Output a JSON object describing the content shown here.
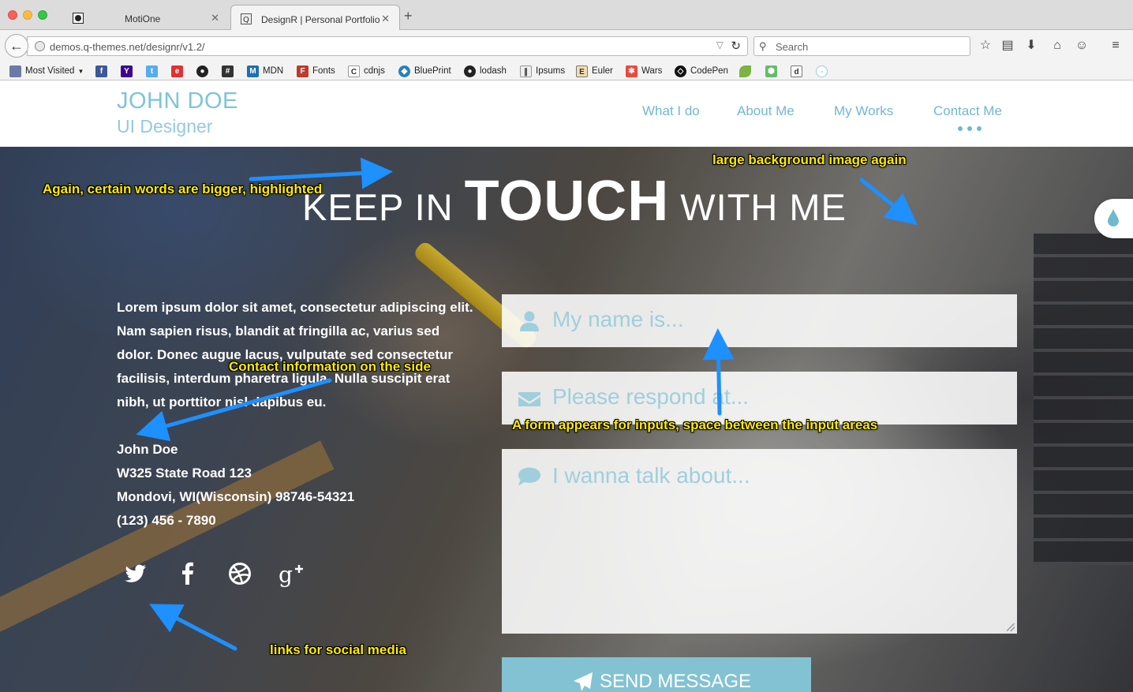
{
  "browser": {
    "tabs": [
      {
        "label": "MotiOne",
        "active": false
      },
      {
        "label": "DesignR | Personal Portfolio",
        "active": true
      }
    ],
    "new_tab": "+",
    "url": "demos.q-themes.net/designr/v1.2/",
    "search_placeholder": "Search",
    "bookmarks": [
      {
        "label": "Most Visited",
        "icon": "folder-icon"
      },
      {
        "label": "",
        "icon": "facebook-icon"
      },
      {
        "label": "",
        "icon": "yahoo-icon"
      },
      {
        "label": "",
        "icon": "twitter-icon"
      },
      {
        "label": "",
        "icon": "ebay-icon"
      },
      {
        "label": "",
        "icon": "github-icon"
      },
      {
        "label": "",
        "icon": "hash-icon"
      },
      {
        "label": "MDN",
        "icon": "mdn-icon"
      },
      {
        "label": "Fonts",
        "icon": "fonts-icon"
      },
      {
        "label": "cdnjs",
        "icon": "cdnjs-icon"
      },
      {
        "label": "BluePrint",
        "icon": "blueprint-icon"
      },
      {
        "label": "lodash",
        "icon": "github-icon"
      },
      {
        "label": "Ipsums",
        "icon": "ipsums-icon"
      },
      {
        "label": "Euler",
        "icon": "euler-icon"
      },
      {
        "label": "Wars",
        "icon": "wars-icon"
      },
      {
        "label": "CodePen",
        "icon": "codepen-icon"
      },
      {
        "label": "",
        "icon": "leaf-icon"
      },
      {
        "label": "",
        "icon": "shield-icon"
      },
      {
        "label": "",
        "icon": "page-icon"
      },
      {
        "label": "",
        "icon": "circle-icon"
      }
    ]
  },
  "header": {
    "name": "JOHN DOE",
    "role": "UI Designer",
    "nav": [
      "What I do",
      "About Me",
      "My Works",
      "Contact Me"
    ]
  },
  "contact": {
    "title_pre": "KEEP IN",
    "title_big": "TOUCH",
    "title_post": "WITH ME",
    "intro": "Lorem ipsum dolor sit amet, consectetur adipiscing elit. Nam sapien risus, blandit at fringilla ac, varius sed dolor. Donec augue lacus, vulputate sed consectetur facilisis, interdum pharetra ligula. Nulla suscipit erat nibh, ut porttitor nisl dapibus eu.",
    "address": [
      "John Doe",
      "W325 State Road 123",
      "Mondovi, WI(Wisconsin) 98746-54321",
      "(123) 456 - 7890"
    ],
    "social_icons": [
      "twitter-icon",
      "facebook-icon",
      "dribbble-icon",
      "google-plus-icon"
    ],
    "form": {
      "name_placeholder": "My name is...",
      "email_placeholder": "Please respond at...",
      "message_placeholder": "I wanna talk about...",
      "send_label": "SEND MESSAGE"
    }
  },
  "annotations": {
    "words": "Again, certain words are bigger, highlighted",
    "background": "large background image again",
    "contact_info": "Contact information on the side",
    "form": "A form appears for inputs, space between the input areas",
    "social": "links for social media"
  },
  "colors": {
    "accent": "#7fc4d6",
    "annotation_text": "#ffeb00",
    "annotation_arrow": "#1e90ff"
  }
}
